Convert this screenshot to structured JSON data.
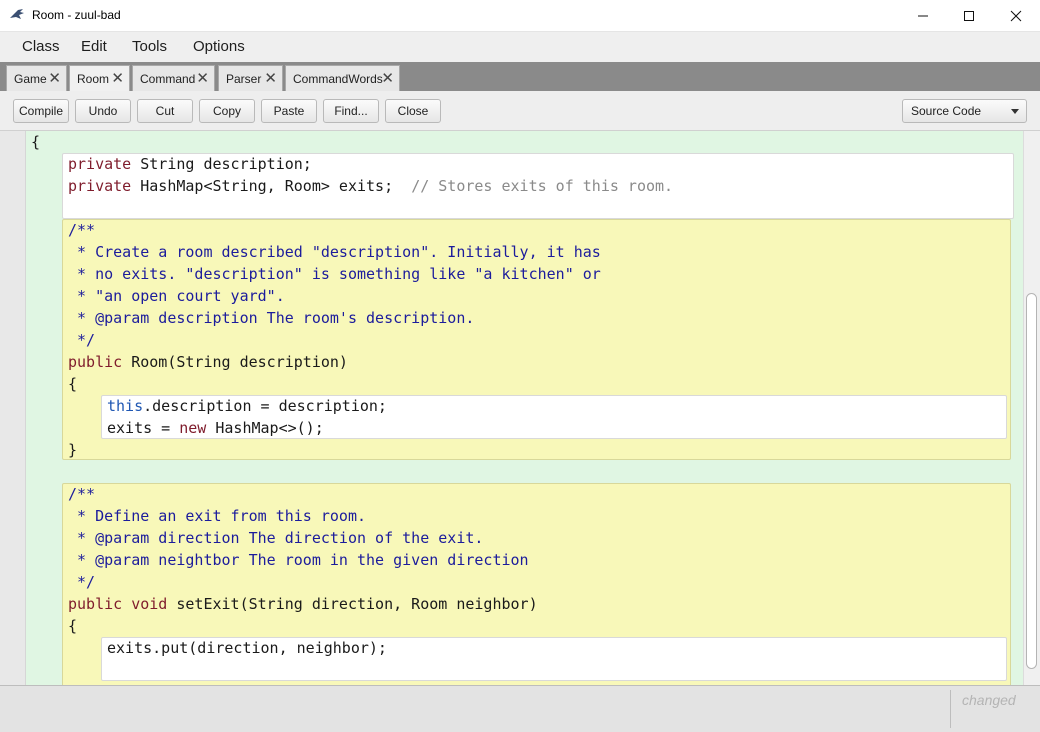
{
  "window": {
    "title": "Room - zuul-bad"
  },
  "menu": [
    "Class",
    "Edit",
    "Tools",
    "Options"
  ],
  "tabs": [
    "Game",
    "Room",
    "Command",
    "Parser",
    "CommandWords"
  ],
  "active_tab": "Room",
  "toolbar": {
    "buttons": [
      "Compile",
      "Undo",
      "Cut",
      "Copy",
      "Paste",
      "Find...",
      "Close"
    ],
    "view_select": "Source Code"
  },
  "code": {
    "lines": [
      [
        [
          "{",
          "p"
        ]
      ],
      [
        [
          "private",
          "kw"
        ],
        [
          " String description;",
          "p"
        ]
      ],
      [
        [
          "private",
          "kw"
        ],
        [
          " HashMap<String, Room> exits;  ",
          "p"
        ],
        [
          "// Stores exits of this room.",
          "cm"
        ]
      ],
      [
        [
          "",
          "p"
        ]
      ],
      [
        [
          "/**",
          "dc"
        ]
      ],
      [
        [
          " * Create a room described \"description\". Initially, it has",
          "dc"
        ]
      ],
      [
        [
          " * no exits. \"description\" is something like \"a kitchen\" or",
          "dc"
        ]
      ],
      [
        [
          " * \"an open court yard\".",
          "dc"
        ]
      ],
      [
        [
          " * @param description The room's description.",
          "dc"
        ]
      ],
      [
        [
          " */",
          "dc"
        ]
      ],
      [
        [
          "public",
          "kw"
        ],
        [
          " Room(String description)",
          "p"
        ]
      ],
      [
        [
          "{",
          "p"
        ]
      ],
      [
        [
          "this",
          "th"
        ],
        [
          ".description = description;",
          "p"
        ]
      ],
      [
        [
          "exits = ",
          "p"
        ],
        [
          "new",
          "kw"
        ],
        [
          " HashMap<>();",
          "p"
        ]
      ],
      [
        [
          "}",
          "p"
        ]
      ],
      [
        [
          "",
          "p"
        ]
      ],
      [
        [
          "/**",
          "dc"
        ]
      ],
      [
        [
          " * Define an exit from this room.",
          "dc"
        ]
      ],
      [
        [
          " * @param direction The direction of the exit.",
          "dc"
        ]
      ],
      [
        [
          " * @param neightbor The room in the given direction",
          "dc"
        ]
      ],
      [
        [
          " */",
          "dc"
        ]
      ],
      [
        [
          "public",
          "kw"
        ],
        [
          " ",
          "p"
        ],
        [
          "void",
          "kw"
        ],
        [
          " setExit(String direction, Room neighbor)",
          "p"
        ]
      ],
      [
        [
          "{",
          "p"
        ]
      ],
      [
        [
          "exits.put(direction, neighbor);",
          "p"
        ]
      ]
    ]
  },
  "status": {
    "text": "changed"
  },
  "colors": {
    "class_scope": "#e0f6e3",
    "method_scope": "#f8f8b9",
    "keyword": "#7f1c2c",
    "doc_comment": "#1c1c9c",
    "comment": "#8a8a8a"
  },
  "icons": {
    "app": "bluej-bird-icon",
    "minimize": "minimize-icon",
    "maximize": "maximize-icon",
    "close": "close-icon",
    "tab_close": "close-icon",
    "dropdown": "chevron-down-icon"
  }
}
